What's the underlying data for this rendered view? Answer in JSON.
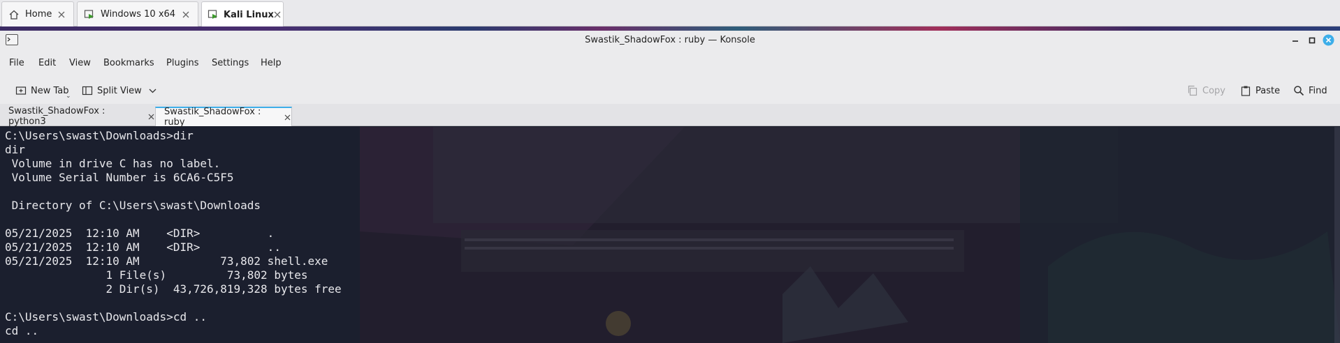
{
  "vm_tabs": [
    {
      "label": "Home",
      "icon": "home-icon",
      "active": false
    },
    {
      "label": "Windows 10 x64",
      "icon": "vm-running-icon",
      "active": false
    },
    {
      "label": "Kali Linux",
      "icon": "vm-running-icon",
      "active": true
    }
  ],
  "window": {
    "title": "Swastik_ShadowFox : ruby — Konsole",
    "app_icon": "terminal-icon"
  },
  "menu": [
    "File",
    "Edit",
    "View",
    "Bookmarks",
    "Plugins",
    "Settings",
    "Help"
  ],
  "toolbar": {
    "new_tab": "New Tab",
    "split_view": "Split View",
    "copy": "Copy",
    "paste": "Paste",
    "find": "Find"
  },
  "terminal_tabs": [
    {
      "label": "Swastik_ShadowFox : python3",
      "active": false
    },
    {
      "label": "Swastik_ShadowFox : ruby",
      "active": true
    }
  ],
  "terminal": {
    "lines": [
      "C:\\Users\\swast\\Downloads>dir",
      "dir",
      " Volume in drive C has no label.",
      " Volume Serial Number is 6CA6-C5F5",
      "",
      " Directory of C:\\Users\\swast\\Downloads",
      "",
      "05/21/2025  12:10 AM    <DIR>          .",
      "05/21/2025  12:10 AM    <DIR>          ..",
      "05/21/2025  12:10 AM            73,802 shell.exe",
      "               1 File(s)         73,802 bytes",
      "               2 Dir(s)  43,726,819,328 bytes free",
      "",
      "C:\\Users\\swast\\Downloads>cd ..",
      "cd .."
    ]
  },
  "colors": {
    "accent": "#3daee9",
    "terminal_text": "#e8e8ec",
    "close_button": "#3daee9"
  }
}
